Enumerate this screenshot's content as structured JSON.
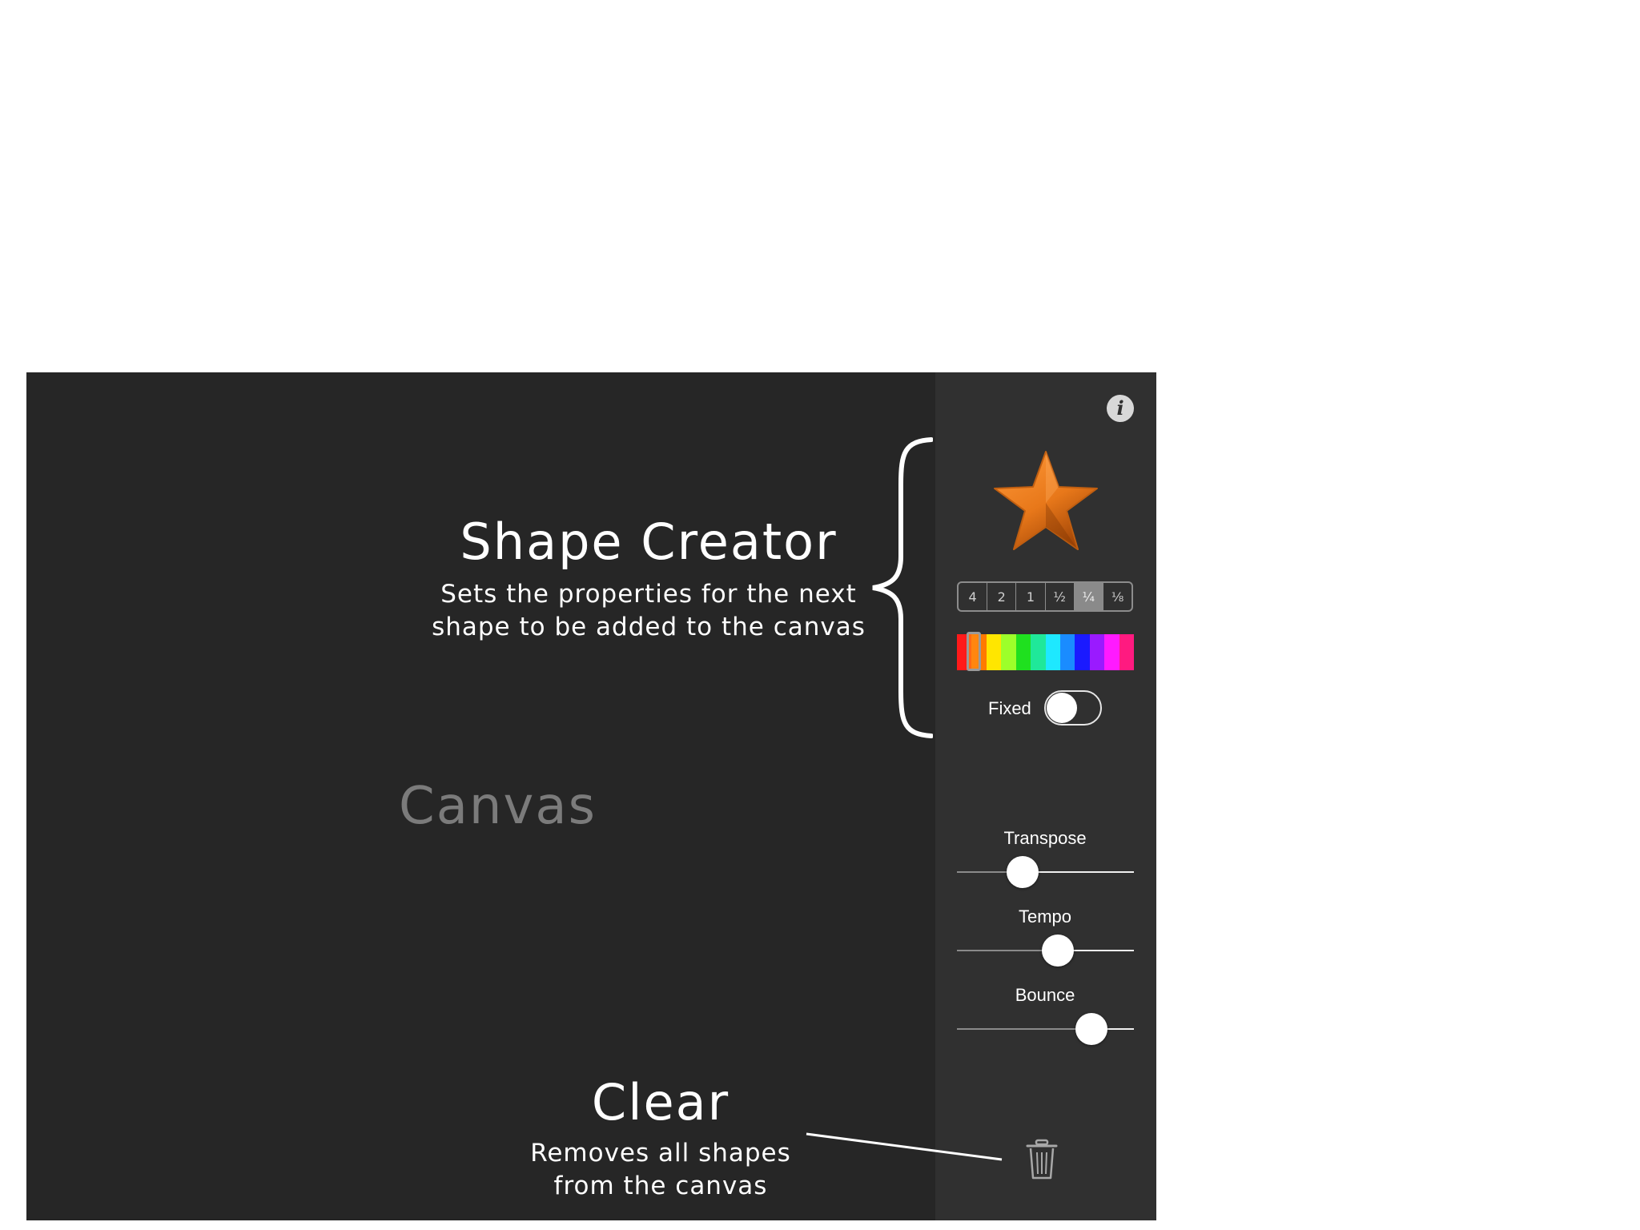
{
  "canvas": {
    "label": "Canvas"
  },
  "annotations": {
    "shape_creator": {
      "title": "Shape Creator",
      "line1": "Sets the properties for the next",
      "line2": "shape to be added to the canvas"
    },
    "clear": {
      "title": "Clear",
      "line1": "Removes all shapes",
      "line2": "from the canvas"
    }
  },
  "sidebar": {
    "info_icon": "info-icon",
    "info_glyph": "i",
    "shape_preview": {
      "shape": "star",
      "color": "#e8781a"
    },
    "note_lengths": [
      "4",
      "2",
      "1",
      "½",
      "¼",
      "⅛"
    ],
    "selected_note_length": "¼",
    "palette": [
      "#ff1a1a",
      "#ff7a00",
      "#ffe600",
      "#9dff2a",
      "#1fe01f",
      "#1fe899",
      "#1ee8ff",
      "#1a8cff",
      "#1a1aff",
      "#9a1aff",
      "#ff1aff",
      "#ff1a80"
    ],
    "selected_color": "#ff7a00",
    "fixed": {
      "label": "Fixed",
      "on": false
    },
    "sliders": [
      {
        "label": "Transpose",
        "value": 0.37
      },
      {
        "label": "Tempo",
        "value": 0.57
      },
      {
        "label": "Bounce",
        "value": 0.76
      }
    ],
    "trash_icon": "trash-icon"
  }
}
